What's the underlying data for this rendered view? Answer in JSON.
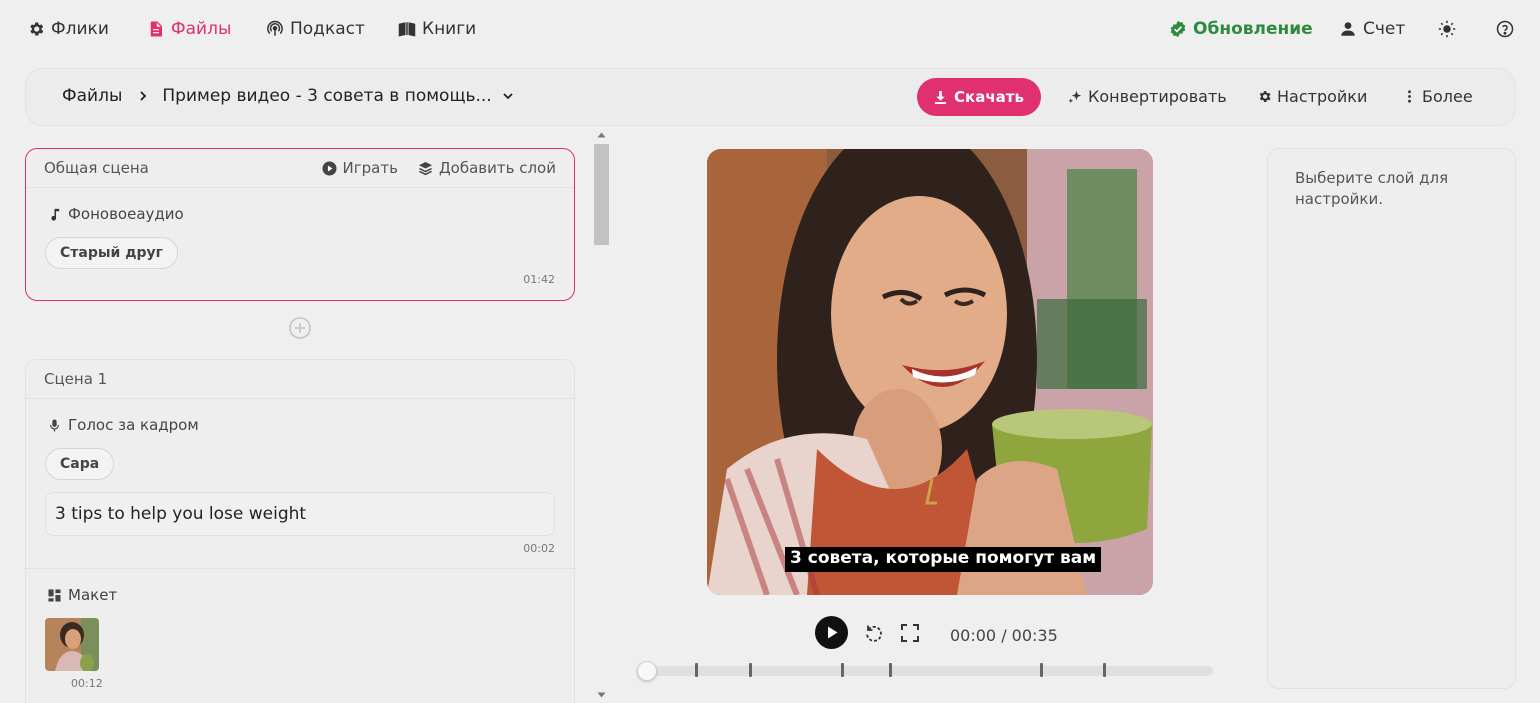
{
  "nav": {
    "flicks": "Флики",
    "files": "Файлы",
    "podcast": "Подкаст",
    "books": "Книги",
    "update": "Обновление",
    "account": "Счет"
  },
  "toolbar": {
    "breadcrumb_root": "Файлы",
    "breadcrumb_current": "Пример видео - 3 совета в помощь...",
    "download_label": "Скачать",
    "convert_label": "Конвертировать",
    "settings_label": "Настройки",
    "more_label": "Более"
  },
  "general_scene": {
    "title": "Общая сцена",
    "play_label": "Играть",
    "add_layer_label": "Добавить слой",
    "background_audio_label": "Фоновоеаудио",
    "track_chip": "Старый друг",
    "duration": "01:42"
  },
  "scene1": {
    "title": "Сцена 1",
    "voiceover_label": "Голос за кадром",
    "voice_chip": "Сара",
    "script_text": "3 tips to help you lose weight",
    "script_duration": "00:02",
    "layout_label": "Макет",
    "layout_duration": "00:12"
  },
  "player": {
    "subtitle": "3 совета, которые помогут вам",
    "time": "00:00 / 00:35",
    "progress": 0
  },
  "right_panel": {
    "hint": "Выберите слой для настройки."
  },
  "colors": {
    "accent": "#e0306f",
    "update_green": "#2e8b3e"
  }
}
